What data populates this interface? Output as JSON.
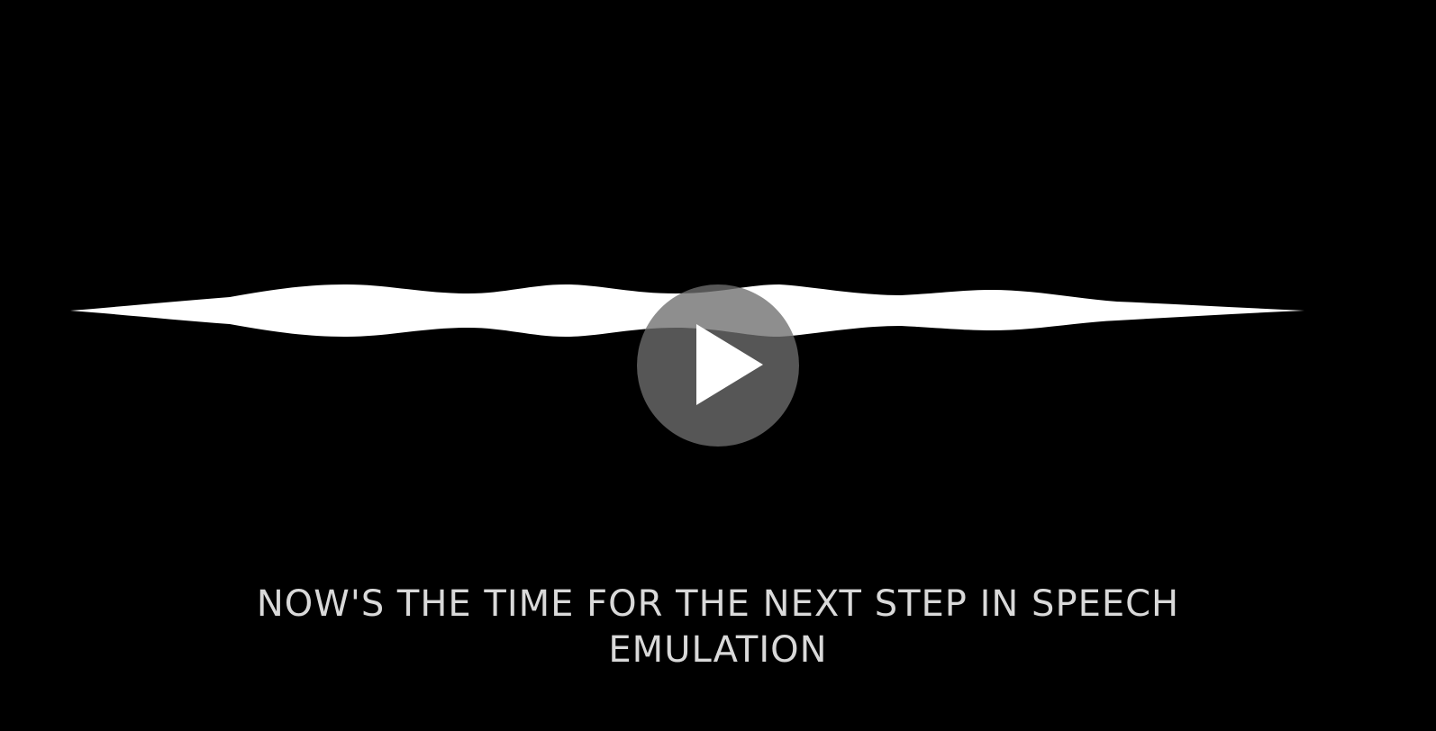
{
  "video": {
    "background_color": "#000000",
    "waveform_color": "#ffffff",
    "play_button": {
      "icon": "play-icon",
      "color": "#6e6e6e"
    },
    "caption": {
      "line1": "NOW'S THE TIME FOR THE NEXT STEP IN SPEECH",
      "line2": "EMULATION"
    }
  }
}
